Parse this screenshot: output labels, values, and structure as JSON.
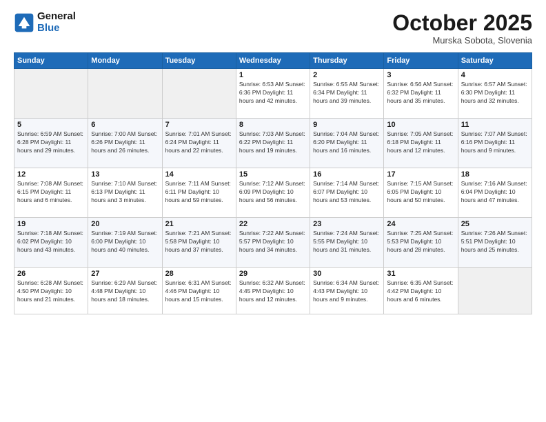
{
  "header": {
    "logo_line1": "General",
    "logo_line2": "Blue",
    "month": "October 2025",
    "location": "Murska Sobota, Slovenia"
  },
  "weekdays": [
    "Sunday",
    "Monday",
    "Tuesday",
    "Wednesday",
    "Thursday",
    "Friday",
    "Saturday"
  ],
  "weeks": [
    [
      {
        "day": "",
        "info": ""
      },
      {
        "day": "",
        "info": ""
      },
      {
        "day": "",
        "info": ""
      },
      {
        "day": "1",
        "info": "Sunrise: 6:53 AM\nSunset: 6:36 PM\nDaylight: 11 hours\nand 42 minutes."
      },
      {
        "day": "2",
        "info": "Sunrise: 6:55 AM\nSunset: 6:34 PM\nDaylight: 11 hours\nand 39 minutes."
      },
      {
        "day": "3",
        "info": "Sunrise: 6:56 AM\nSunset: 6:32 PM\nDaylight: 11 hours\nand 35 minutes."
      },
      {
        "day": "4",
        "info": "Sunrise: 6:57 AM\nSunset: 6:30 PM\nDaylight: 11 hours\nand 32 minutes."
      }
    ],
    [
      {
        "day": "5",
        "info": "Sunrise: 6:59 AM\nSunset: 6:28 PM\nDaylight: 11 hours\nand 29 minutes."
      },
      {
        "day": "6",
        "info": "Sunrise: 7:00 AM\nSunset: 6:26 PM\nDaylight: 11 hours\nand 26 minutes."
      },
      {
        "day": "7",
        "info": "Sunrise: 7:01 AM\nSunset: 6:24 PM\nDaylight: 11 hours\nand 22 minutes."
      },
      {
        "day": "8",
        "info": "Sunrise: 7:03 AM\nSunset: 6:22 PM\nDaylight: 11 hours\nand 19 minutes."
      },
      {
        "day": "9",
        "info": "Sunrise: 7:04 AM\nSunset: 6:20 PM\nDaylight: 11 hours\nand 16 minutes."
      },
      {
        "day": "10",
        "info": "Sunrise: 7:05 AM\nSunset: 6:18 PM\nDaylight: 11 hours\nand 12 minutes."
      },
      {
        "day": "11",
        "info": "Sunrise: 7:07 AM\nSunset: 6:16 PM\nDaylight: 11 hours\nand 9 minutes."
      }
    ],
    [
      {
        "day": "12",
        "info": "Sunrise: 7:08 AM\nSunset: 6:15 PM\nDaylight: 11 hours\nand 6 minutes."
      },
      {
        "day": "13",
        "info": "Sunrise: 7:10 AM\nSunset: 6:13 PM\nDaylight: 11 hours\nand 3 minutes."
      },
      {
        "day": "14",
        "info": "Sunrise: 7:11 AM\nSunset: 6:11 PM\nDaylight: 10 hours\nand 59 minutes."
      },
      {
        "day": "15",
        "info": "Sunrise: 7:12 AM\nSunset: 6:09 PM\nDaylight: 10 hours\nand 56 minutes."
      },
      {
        "day": "16",
        "info": "Sunrise: 7:14 AM\nSunset: 6:07 PM\nDaylight: 10 hours\nand 53 minutes."
      },
      {
        "day": "17",
        "info": "Sunrise: 7:15 AM\nSunset: 6:05 PM\nDaylight: 10 hours\nand 50 minutes."
      },
      {
        "day": "18",
        "info": "Sunrise: 7:16 AM\nSunset: 6:04 PM\nDaylight: 10 hours\nand 47 minutes."
      }
    ],
    [
      {
        "day": "19",
        "info": "Sunrise: 7:18 AM\nSunset: 6:02 PM\nDaylight: 10 hours\nand 43 minutes."
      },
      {
        "day": "20",
        "info": "Sunrise: 7:19 AM\nSunset: 6:00 PM\nDaylight: 10 hours\nand 40 minutes."
      },
      {
        "day": "21",
        "info": "Sunrise: 7:21 AM\nSunset: 5:58 PM\nDaylight: 10 hours\nand 37 minutes."
      },
      {
        "day": "22",
        "info": "Sunrise: 7:22 AM\nSunset: 5:57 PM\nDaylight: 10 hours\nand 34 minutes."
      },
      {
        "day": "23",
        "info": "Sunrise: 7:24 AM\nSunset: 5:55 PM\nDaylight: 10 hours\nand 31 minutes."
      },
      {
        "day": "24",
        "info": "Sunrise: 7:25 AM\nSunset: 5:53 PM\nDaylight: 10 hours\nand 28 minutes."
      },
      {
        "day": "25",
        "info": "Sunrise: 7:26 AM\nSunset: 5:51 PM\nDaylight: 10 hours\nand 25 minutes."
      }
    ],
    [
      {
        "day": "26",
        "info": "Sunrise: 6:28 AM\nSunset: 4:50 PM\nDaylight: 10 hours\nand 21 minutes."
      },
      {
        "day": "27",
        "info": "Sunrise: 6:29 AM\nSunset: 4:48 PM\nDaylight: 10 hours\nand 18 minutes."
      },
      {
        "day": "28",
        "info": "Sunrise: 6:31 AM\nSunset: 4:46 PM\nDaylight: 10 hours\nand 15 minutes."
      },
      {
        "day": "29",
        "info": "Sunrise: 6:32 AM\nSunset: 4:45 PM\nDaylight: 10 hours\nand 12 minutes."
      },
      {
        "day": "30",
        "info": "Sunrise: 6:34 AM\nSunset: 4:43 PM\nDaylight: 10 hours\nand 9 minutes."
      },
      {
        "day": "31",
        "info": "Sunrise: 6:35 AM\nSunset: 4:42 PM\nDaylight: 10 hours\nand 6 minutes."
      },
      {
        "day": "",
        "info": ""
      }
    ]
  ]
}
